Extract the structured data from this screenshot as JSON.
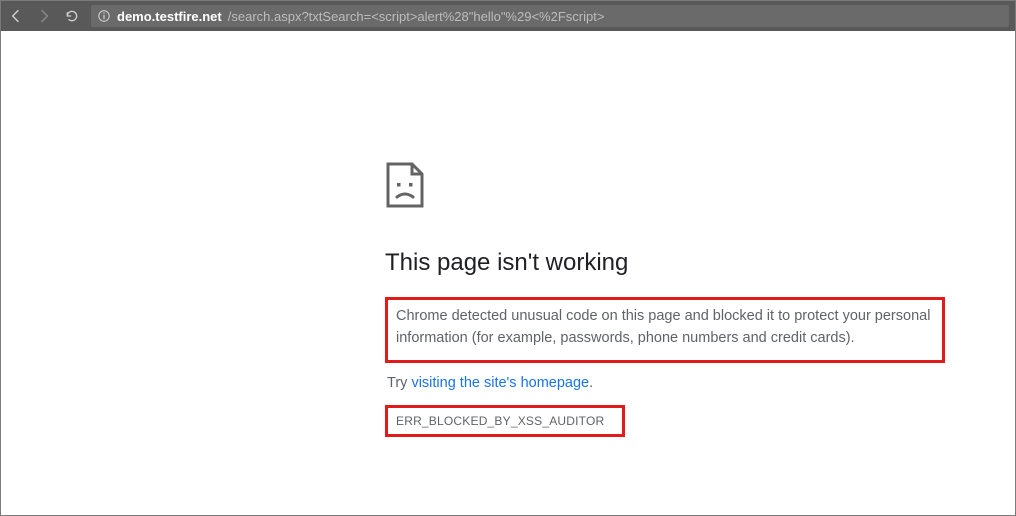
{
  "address": {
    "host": "demo.testfire.net",
    "path": "/search.aspx?txtSearch=<script>alert%28\"hello\"%29<%2Fscript>"
  },
  "error": {
    "title": "This page isn't working",
    "description": "Chrome detected unusual code on this page and blocked it to protect your personal information (for example, passwords, phone numbers and credit cards).",
    "try_prefix": "Try ",
    "try_link": "visiting the site's homepage",
    "try_suffix": ".",
    "code": "ERR_BLOCKED_BY_XSS_AUDITOR"
  },
  "highlight_color": "#e11a1a"
}
